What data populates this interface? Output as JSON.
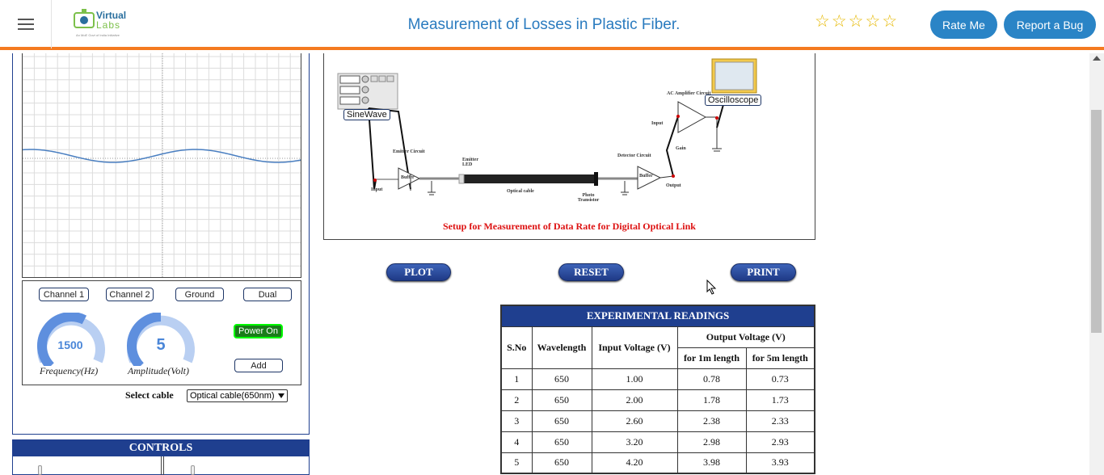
{
  "header": {
    "logo_top": "Virtual",
    "logo_bottom": "Labs",
    "logo_tag": "An MoE Govt of India Initiative",
    "title": "Measurement of Losses in Plastic Fiber.",
    "stars": [
      "☆",
      "☆",
      "☆",
      "☆",
      "☆"
    ],
    "rate_label": "Rate Me",
    "bug_label": "Report a Bug"
  },
  "oscilloscope": {
    "buttons": {
      "channel1": "Channel 1",
      "channel2": "Channel 2",
      "ground": "Ground",
      "dual": "Dual",
      "power": "Power On",
      "add": "Add"
    },
    "frequency": {
      "value": "1500",
      "label": "Frequency(Hz)",
      "level": 0.6
    },
    "amplitude": {
      "value": "5",
      "label": "Amplitude(Volt)",
      "level": 0.5
    },
    "select_label": "Select cable",
    "select_value": "Optical cable(650nm)"
  },
  "controls_title": "CONTROLS",
  "diagram": {
    "sinewave_label": "SineWave",
    "oscilloscope_label": "Oscilloscope",
    "emitter_circuit": "Emitter Circuit",
    "emitter_led": "Emitter LED",
    "buffer": "Buffer",
    "input": "Input",
    "optical_cable": "Optical cable",
    "photo_transistor": "Photo Transistor",
    "detector_circuit": "Detector Circuit",
    "output": "Output",
    "ac_amp": "AC Amplifier Circuit",
    "gain": "Gain",
    "caption": "Setup for Measurement of Data Rate for Digital Optical Link"
  },
  "actions": {
    "plot": "PLOT",
    "reset": "RESET",
    "print": "PRINT"
  },
  "table": {
    "title": "EXPERIMENTAL READINGS",
    "col_sno": "S.No",
    "col_wavelength": "Wavelength",
    "col_input": "Input Voltage (V)",
    "col_output": "Output Voltage (V)",
    "col_1m": "for 1m length",
    "col_5m": "for 5m length",
    "rows": [
      [
        "1",
        "650",
        "1.00",
        "0.78",
        "0.73"
      ],
      [
        "2",
        "650",
        "2.00",
        "1.78",
        "1.73"
      ],
      [
        "3",
        "650",
        "2.60",
        "2.38",
        "2.33"
      ],
      [
        "4",
        "650",
        "3.20",
        "2.98",
        "2.93"
      ],
      [
        "5",
        "650",
        "4.20",
        "3.98",
        "3.93"
      ]
    ]
  }
}
